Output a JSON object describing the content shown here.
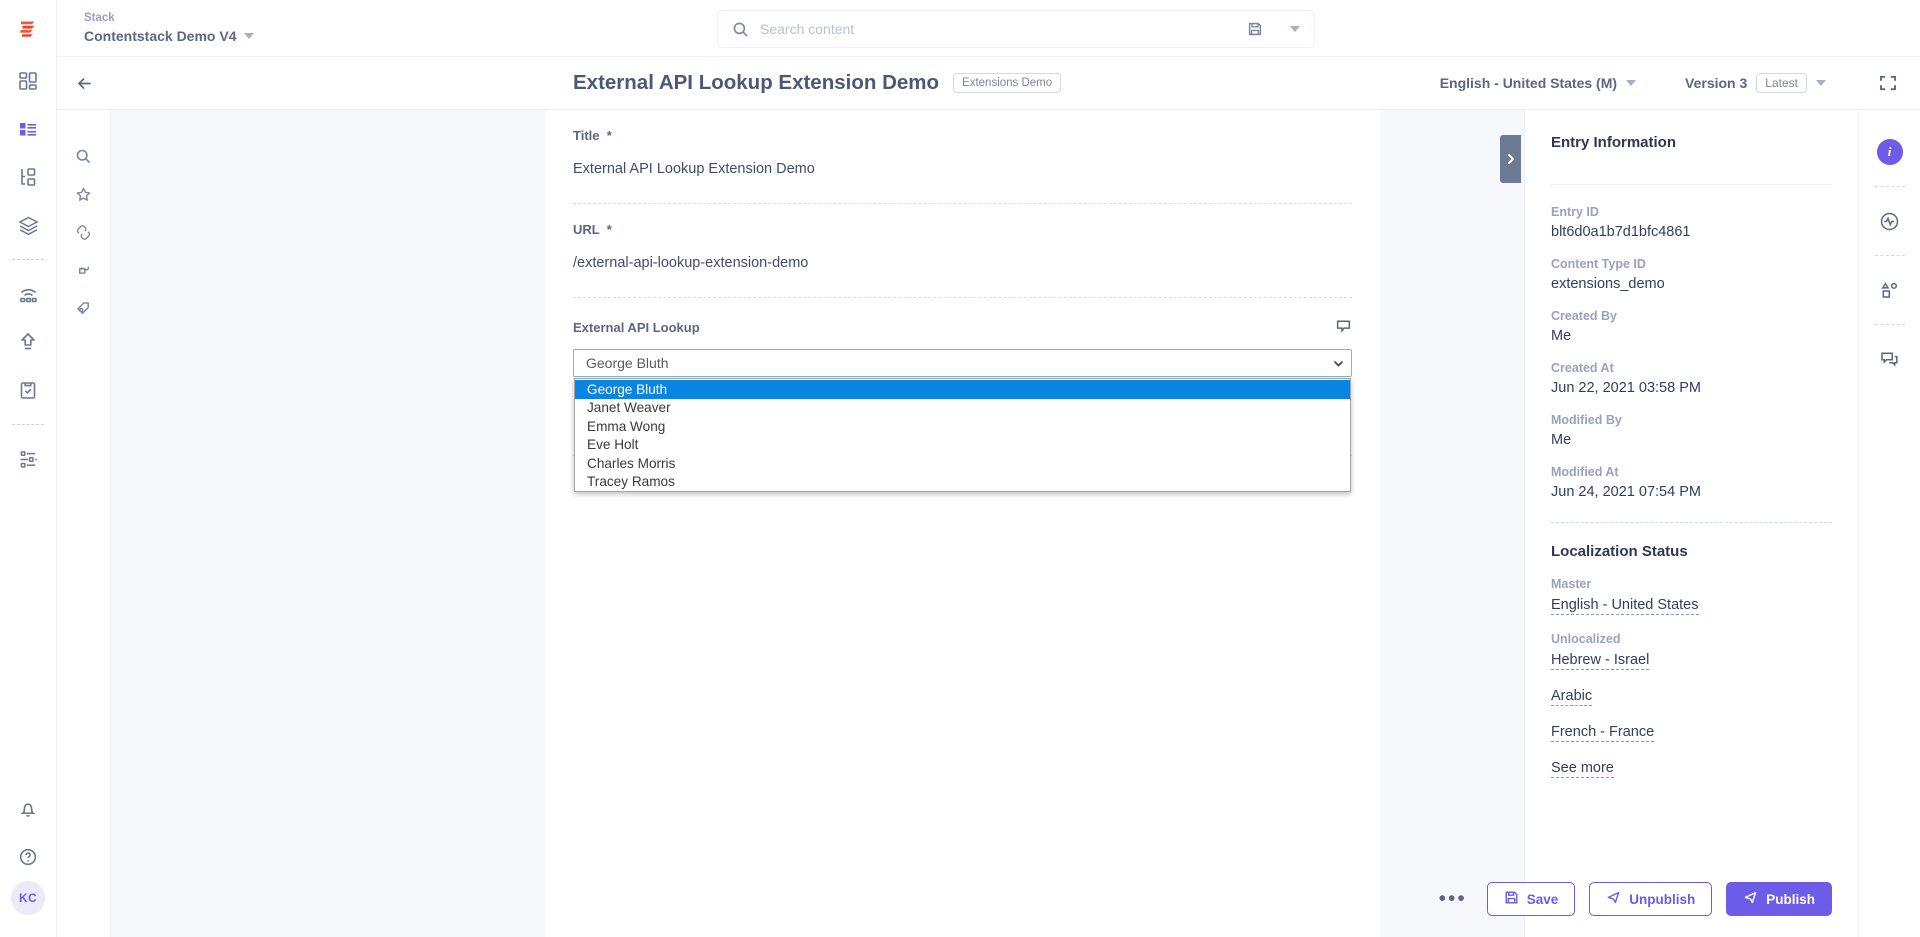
{
  "brand": {
    "accent": "#6c5ce7",
    "logo_icon": "contentstack-logo-icon"
  },
  "topbar": {
    "stack_label": "Stack",
    "stack_name": "Contentstack Demo V4",
    "search_placeholder": "Search content"
  },
  "entry_header": {
    "title": "External API Lookup Extension Demo",
    "content_type_badge": "Extensions Demo",
    "locale": "English - United States (M)",
    "version": "Version 3",
    "version_pill": "Latest"
  },
  "form": {
    "fields": [
      {
        "label": "Title",
        "required": true,
        "value": "External API Lookup Extension Demo"
      },
      {
        "label": "URL",
        "required": true,
        "value": "/external-api-lookup-extension-demo"
      }
    ],
    "lookup": {
      "label": "External API Lookup",
      "selected": "George Bluth",
      "options": [
        "George Bluth",
        "Janet Weaver",
        "Emma Wong",
        "Eve Holt",
        "Charles Morris",
        "Tracey Ramos"
      ],
      "highlight_color": "#0a84e3"
    }
  },
  "info_panel": {
    "title": "Entry Information",
    "fields": [
      {
        "key": "Entry ID",
        "value": "blt6d0a1b7d1bfc4861"
      },
      {
        "key": "Content Type ID",
        "value": "extensions_demo"
      },
      {
        "key": "Created By",
        "value": "Me"
      },
      {
        "key": "Created At",
        "value": "Jun 22, 2021 03:58 PM"
      },
      {
        "key": "Modified By",
        "value": "Me"
      },
      {
        "key": "Modified At",
        "value": "Jun 24, 2021 07:54 PM"
      }
    ],
    "localization": {
      "title": "Localization Status",
      "master_label": "Master",
      "master_value": "English - United States",
      "unlocalized_label": "Unlocalized",
      "unlocalized": [
        "Hebrew - Israel",
        "Arabic",
        "French - France"
      ],
      "see_more": "See more"
    }
  },
  "actions": {
    "more_label": "•••",
    "save_label": "Save",
    "unpublish_label": "Unpublish",
    "publish_label": "Publish"
  },
  "left_rail_icons": [
    "dashboard-grid-icon",
    "content-types-icon",
    "content-structure-icon",
    "stacks-layers-icon",
    "releases-icon",
    "publish-queue-icon",
    "audit-log-icon",
    "settings-sliders-icon"
  ],
  "tool_strip_icons": [
    "search-icon",
    "star-icon",
    "link-icon",
    "extension-plug-icon",
    "tag-icon"
  ],
  "right_rail_icons": [
    "info-icon",
    "activity-pulse-icon",
    "variants-shapes-icon",
    "comments-icon"
  ],
  "avatar_initials": "KC"
}
